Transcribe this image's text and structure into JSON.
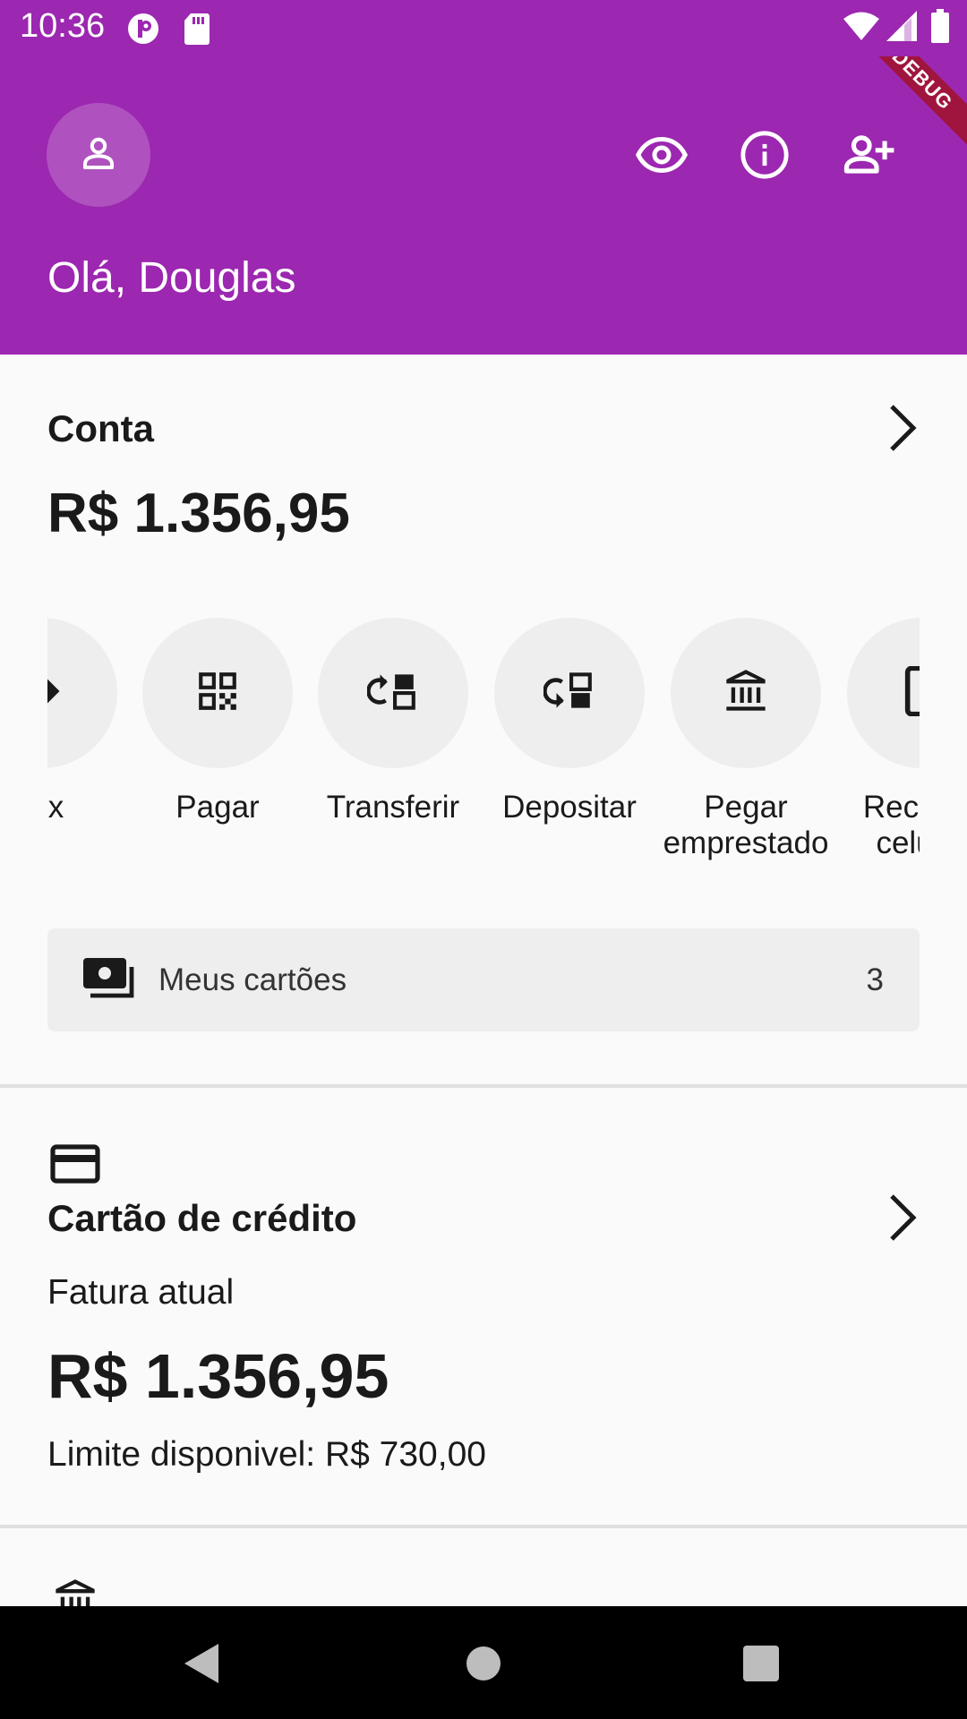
{
  "status_bar": {
    "time": "10:36"
  },
  "header": {
    "greeting": "Olá, Douglas",
    "debug_label": "DEBUG",
    "color": "#9c27b0"
  },
  "account": {
    "title": "Conta",
    "balance": "R$ 1.356,95",
    "actions": [
      {
        "label": "Pix",
        "icon": "pix-icon"
      },
      {
        "label": "Pagar",
        "icon": "qr-code-icon"
      },
      {
        "label": "Transferir",
        "icon": "transfer-icon"
      },
      {
        "label": "Depositar",
        "icon": "deposit-icon"
      },
      {
        "label": "Pegar emprestado",
        "icon": "bank-icon"
      },
      {
        "label": "Recarga celular",
        "icon": "phone-icon"
      }
    ],
    "cards_button": {
      "label": "Meus cartões",
      "count": "3"
    }
  },
  "credit_card": {
    "title": "Cartão de crédito",
    "subtitle": "Fatura atual",
    "amount": "R$ 1.356,95",
    "limit": "Limite disponivel: R$ 730,00"
  }
}
